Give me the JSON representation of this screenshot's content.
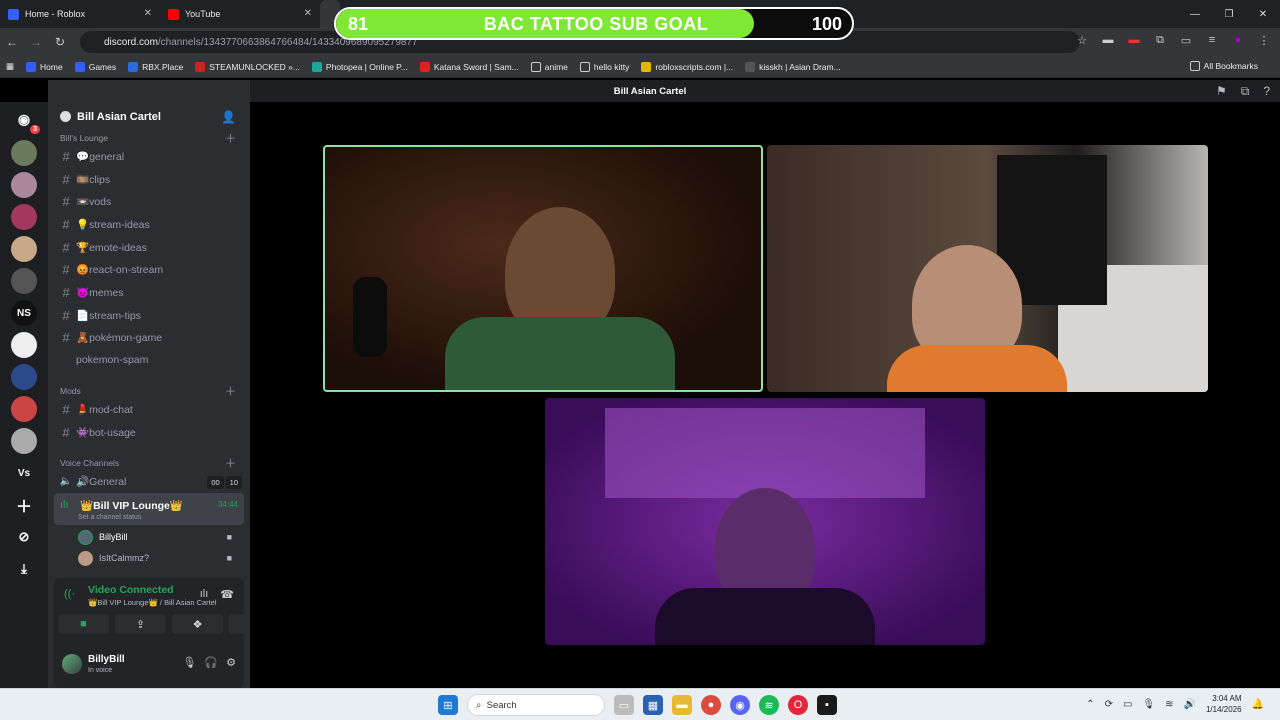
{
  "browser": {
    "tabs": [
      {
        "label": "Home - Roblox",
        "color": "#335fff"
      },
      {
        "label": "YouTube",
        "color": "#ff0000"
      }
    ],
    "url_host": "discord.com",
    "url_path": "/channels/1343770663864766484/1433409689095279877",
    "bookmarks": [
      "Home",
      "Games",
      "RBX.Place",
      "STEAMUNLOCKED »...",
      "Photopea | Online P...",
      "Katana Sword | Sam...",
      "anime",
      "hello kitty",
      "robloxscripts.com |...",
      "kisskh | Asian Dram..."
    ],
    "all_bookmarks": "All Bookmarks"
  },
  "goal": {
    "current": "81",
    "title": "BAC TATTOO SUB GOAL",
    "target": "100",
    "progress": 0.81
  },
  "discord": {
    "server_name": "Bill Asian Cartel",
    "channel_title": "Bill Asian Cartel",
    "home_badge": "3",
    "server_ns": "NS",
    "server_vs": "Vs",
    "cat_lounge": "Bill's Lounge",
    "text_channels": [
      "💬general",
      "🎞️clips",
      "📼vods",
      "💡stream-ideas",
      "🏆emote-ideas",
      "😡react-on-stream",
      "😈memes",
      "📄stream-tips",
      "🧸pokémon-game",
      "pokemon-spam"
    ],
    "cat_mods": "Mods",
    "mod_channels": [
      "💄mod-chat",
      "👾bot-usage"
    ],
    "cat_voice": "Voice Channels",
    "voice_general": "🔊General",
    "count_a": "00",
    "count_b": "10",
    "vip_lounge": "👑Bill VIP Lounge👑",
    "vip_status": "Set a channel status",
    "vip_time": "34:44",
    "members": [
      "BillyBill",
      "IsItCalmmz?"
    ],
    "video_connected": "Video Connected",
    "video_sub": "👑Bill VIP Lounge👑 / Bill Asian Cartel",
    "user_name": "BillyBill",
    "user_status": "In voice"
  },
  "taskbar": {
    "search": "Search",
    "time": "3:04 AM",
    "date": "1/14/2026"
  }
}
